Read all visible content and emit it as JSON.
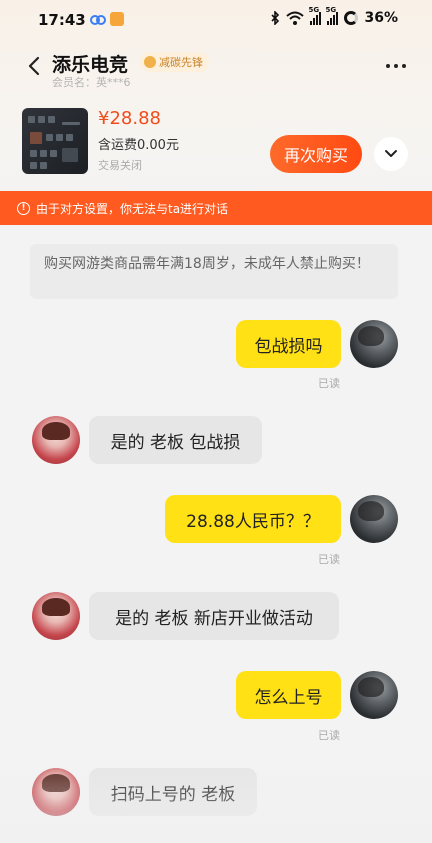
{
  "status_bar": {
    "time": "17:43",
    "signal1_label": "5G",
    "signal2_label": "5G",
    "battery": "36%"
  },
  "header": {
    "shop_name": "添乐电竞",
    "badge": "减碳先锋",
    "member": "会员名：",
    "member_name": "英***6"
  },
  "product": {
    "price": "¥28.88",
    "shipping": "含运费0.00元",
    "status": "交易关闭",
    "buy_again": "再次购买"
  },
  "warning": {
    "text": "由于对方设置，你无法与ta进行对话"
  },
  "notice": {
    "text": "购买网游类商品需年满18周岁，未成年人禁止购买！"
  },
  "messages": [
    {
      "from": "me",
      "text": "包战损吗",
      "read": "已读"
    },
    {
      "from": "them",
      "text": "是的 老板 包战损"
    },
    {
      "from": "me",
      "text": "28.88人民币？？",
      "read": "已读"
    },
    {
      "from": "them",
      "text": "是的 老板 新店开业做活动"
    },
    {
      "from": "me",
      "text": "怎么上号",
      "read": "已读"
    },
    {
      "from": "them",
      "text": "扫码上号的 老板"
    }
  ],
  "colors": {
    "accent_orange": "#ff5a1f",
    "price_red": "#f04d1d",
    "my_bubble": "#ffe116",
    "their_bubble": "#e6e6e6"
  },
  "icons": [
    "back-arrow-icon",
    "carbon-badge-icon",
    "more-icon",
    "chevron-down-icon",
    "warning-icon",
    "bluetooth-icon",
    "wifi-icon",
    "battery-icon"
  ]
}
